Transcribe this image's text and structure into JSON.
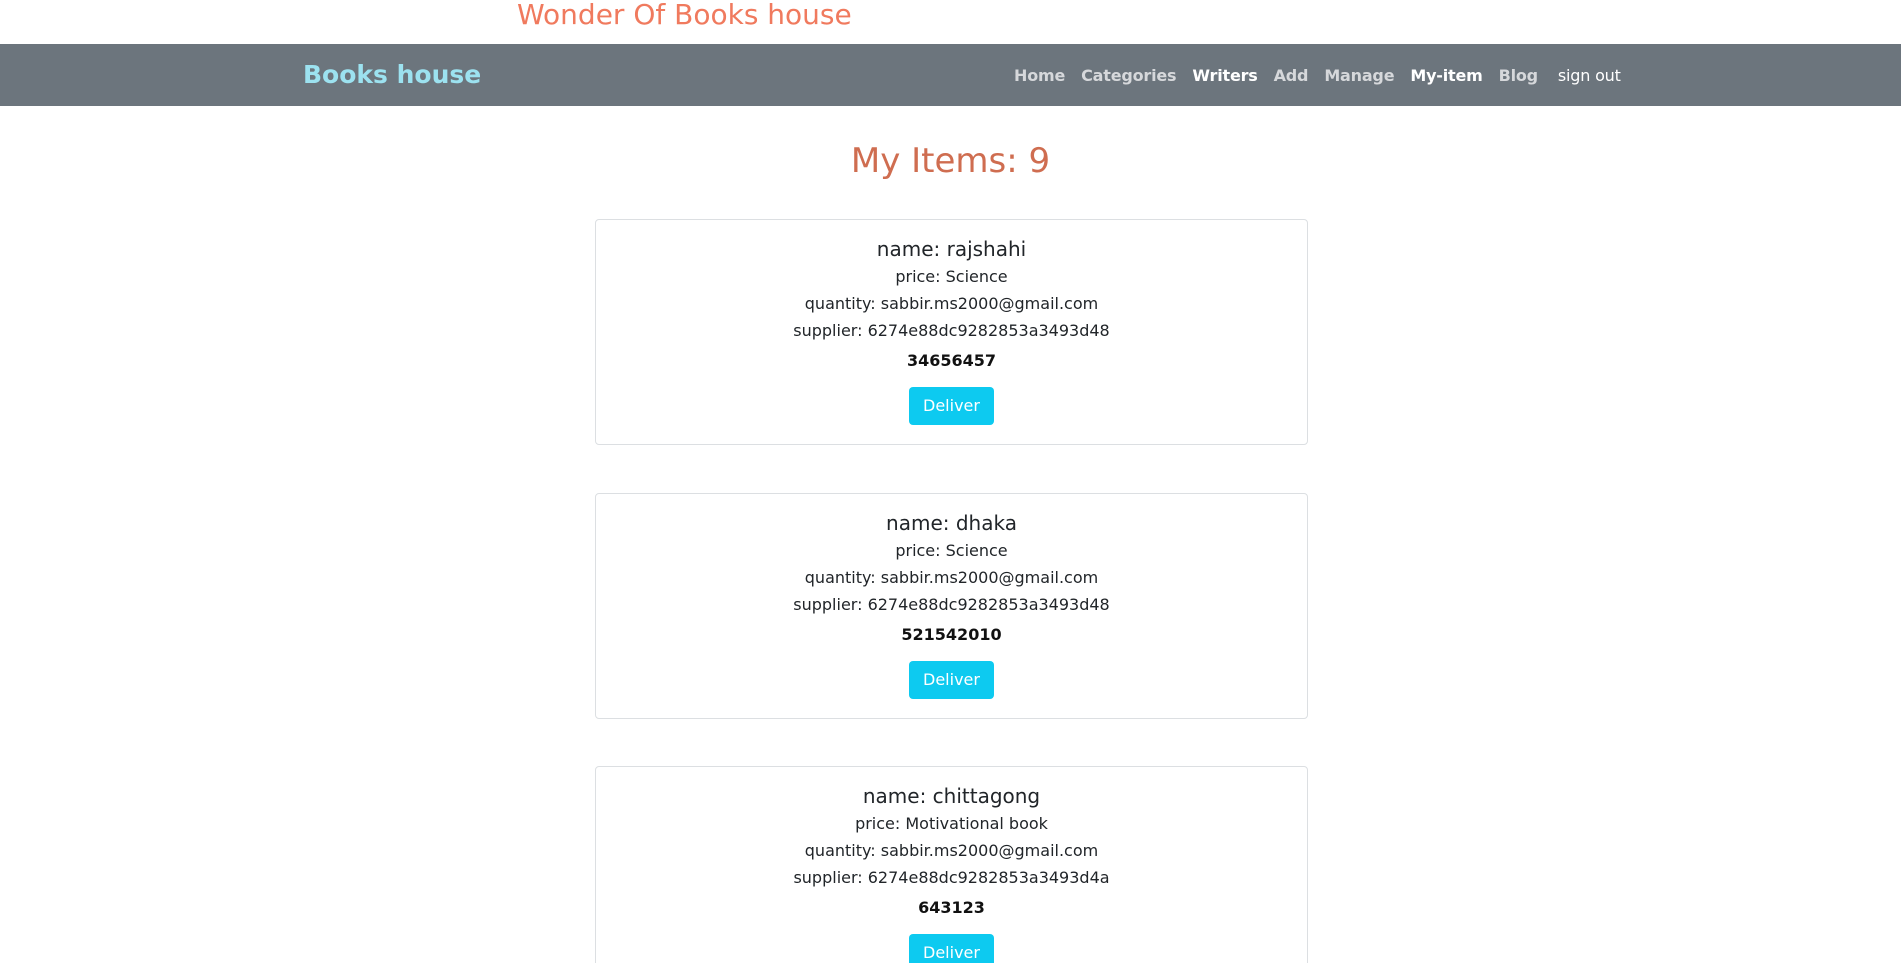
{
  "banner": {
    "title": "Wonder Of Books house"
  },
  "navbar": {
    "brand": "Books house",
    "links": [
      "Home",
      "Categories",
      "Writers",
      "Add",
      "Manage",
      "My-item",
      "Blog"
    ],
    "signout": "sign out"
  },
  "page": {
    "heading": "My Items: 9"
  },
  "items": [
    {
      "name": "name: rajshahi",
      "price": "price: Science",
      "quantity": "quantity: sabbir.ms2000@gmail.com",
      "supplier": "supplier: 6274e88dc9282853a3493d48",
      "id": "34656457",
      "button": "Deliver"
    },
    {
      "name": "name: dhaka",
      "price": "price: Science",
      "quantity": "quantity: sabbir.ms2000@gmail.com",
      "supplier": "supplier: 6274e88dc9282853a3493d48",
      "id": "521542010",
      "button": "Deliver"
    },
    {
      "name": "name: chittagong",
      "price": "price: Motivational book",
      "quantity": "quantity: sabbir.ms2000@gmail.com",
      "supplier": "supplier: 6274e88dc9282853a3493d4a",
      "id": "643123",
      "button": "Deliver"
    }
  ],
  "colors": {
    "title": "#f07a5e",
    "navbar": "#6c757d",
    "brand": "#9ce2f0",
    "heading": "#cf6d50",
    "button": "#0dcaf0"
  }
}
